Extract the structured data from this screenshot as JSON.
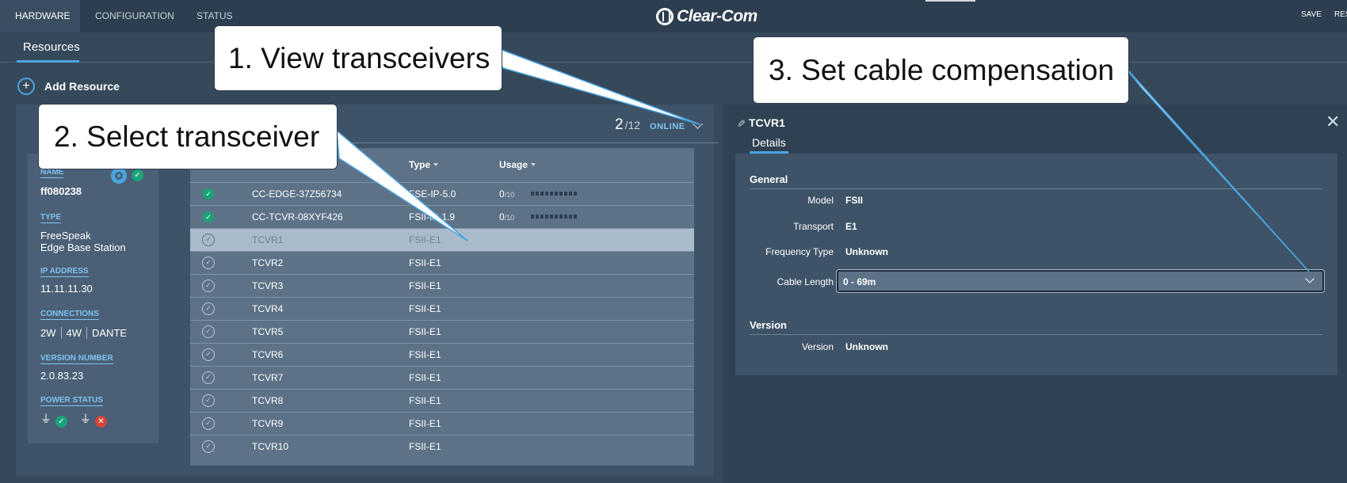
{
  "top_nav": {
    "tabs": [
      {
        "label": "HARDWARE",
        "active": true
      },
      {
        "label": "CONFIGURATION",
        "active": false
      },
      {
        "label": "STATUS",
        "active": false
      }
    ],
    "logo": "Clear-Com",
    "actions": {
      "save": "SAVE",
      "reset": "RES"
    }
  },
  "sub_nav": {
    "tab": "Resources"
  },
  "add_resource": {
    "label": "Add Resource"
  },
  "resource_header": {
    "online_count": "2",
    "total": "/12",
    "online_label": "ONLINE"
  },
  "device": {
    "name_label": "NAME",
    "name": "ff080238",
    "type_label": "TYPE",
    "type_line1": "FreeSpeak",
    "type_line2": "Edge Base Station",
    "ip_label": "IP ADDRESS",
    "ip": "11.11.11.30",
    "connections_label": "CONNECTIONS",
    "connections": [
      "2W",
      "4W",
      "DANTE"
    ],
    "version_label": "VERSION NUMBER",
    "version": "2.0.83.23",
    "power_label": "POWER STATUS"
  },
  "table": {
    "headers": {
      "type": "Type",
      "usage": "Usage"
    },
    "rows": [
      {
        "name": "CC-EDGE-37Z56734",
        "type": "FSE-IP-5.0",
        "usage": "0",
        "usage_max": "/10",
        "status": "online"
      },
      {
        "name": "CC-TCVR-08XYF426",
        "type": "FSII-IP-1.9",
        "usage": "0",
        "usage_max": "/10",
        "status": "online"
      },
      {
        "name": "TCVR1",
        "type": "FSII-E1",
        "status": "offline",
        "selected": true
      },
      {
        "name": "TCVR2",
        "type": "FSII-E1",
        "status": "offline"
      },
      {
        "name": "TCVR3",
        "type": "FSII-E1",
        "status": "offline"
      },
      {
        "name": "TCVR4",
        "type": "FSII-E1",
        "status": "offline"
      },
      {
        "name": "TCVR5",
        "type": "FSII-E1",
        "status": "offline"
      },
      {
        "name": "TCVR6",
        "type": "FSII-E1",
        "status": "offline"
      },
      {
        "name": "TCVR7",
        "type": "FSII-E1",
        "status": "offline"
      },
      {
        "name": "TCVR8",
        "type": "FSII-E1",
        "status": "offline"
      },
      {
        "name": "TCVR9",
        "type": "FSII-E1",
        "status": "offline"
      },
      {
        "name": "TCVR10",
        "type": "FSII-E1",
        "status": "offline"
      }
    ]
  },
  "details": {
    "title": "TCVR1",
    "tab": "Details",
    "general_title": "General",
    "model_label": "Model",
    "model": "FSII",
    "transport_label": "Transport",
    "transport": "E1",
    "freq_label": "Frequency Type",
    "freq": "Unknown",
    "cable_label": "Cable Length",
    "cable": "0 - 69m",
    "version_title": "Version",
    "version_label": "Version",
    "version": "Unknown"
  },
  "callouts": {
    "one": "1. View transceivers",
    "two": "2. Select transceiver",
    "three": "3. Set cable compensation"
  },
  "colors": {
    "accent": "#4aa3df",
    "online": "#1aa37a",
    "error": "#d6453a"
  }
}
